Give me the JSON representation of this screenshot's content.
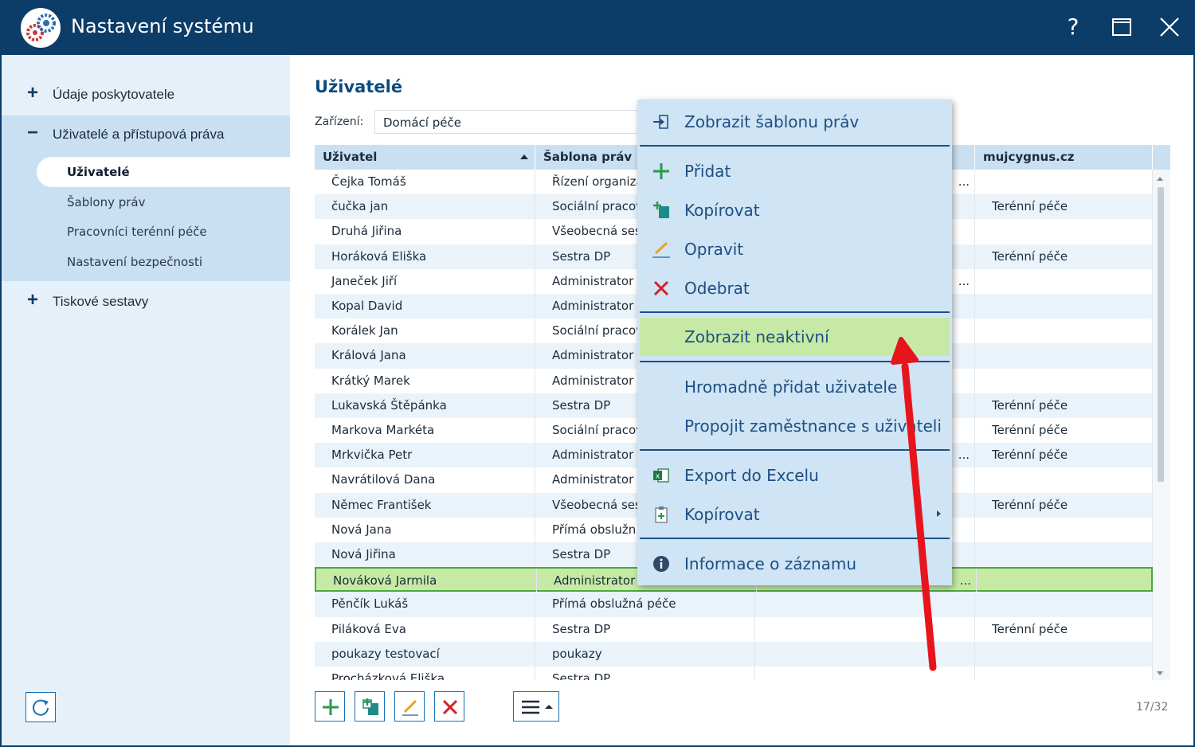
{
  "window": {
    "title": "Nastavení systému",
    "help": "?"
  },
  "sidebar": {
    "items": [
      {
        "sign": "+",
        "label": "Údaje poskytovatele"
      },
      {
        "sign": "−",
        "label": "Uživatelé a přístupová práva"
      },
      {
        "sign": "+",
        "label": "Tiskové sestavy"
      }
    ],
    "subitems": [
      {
        "label": "Uživatelé",
        "active": true
      },
      {
        "label": "Šablony práv"
      },
      {
        "label": "Pracovníci terénní péče"
      },
      {
        "label": "Nastavení bezpečnosti"
      }
    ]
  },
  "main": {
    "title": "Uživatelé",
    "facility_label": "Zařízení:",
    "facility_value": "Domácí péče"
  },
  "table": {
    "columns": [
      "Uživatel",
      "Šablona práv",
      "",
      "mujcygnus.cz"
    ],
    "rows": [
      [
        "Čejka Tomáš",
        "Řízení organiza",
        "...",
        ""
      ],
      [
        "čučka jan",
        "Sociální pracov",
        "",
        "Terénní péče"
      ],
      [
        "Druhá Jiřina",
        "Všeobecná ses",
        "",
        ""
      ],
      [
        "Horáková Eliška",
        "Sestra DP",
        "",
        "Terénní péče"
      ],
      [
        "Janeček Jiří",
        "Administrator",
        "...",
        ""
      ],
      [
        "Kopal David",
        "Administrator",
        "",
        ""
      ],
      [
        "Korálek Jan",
        "Sociální pracov",
        "",
        ""
      ],
      [
        "Králová Jana",
        "Administrator",
        "",
        ""
      ],
      [
        "Krátký Marek",
        "Administrator",
        "",
        ""
      ],
      [
        "Lukavská Štěpánka",
        "Sestra DP",
        "",
        "Terénní péče"
      ],
      [
        "Markova Markéta",
        "Sociální pracov",
        "",
        "Terénní péče"
      ],
      [
        "Mrkvička Petr",
        "Administrator",
        "...",
        "Terénní péče"
      ],
      [
        "Navrátilová Dana",
        "Administrator",
        "",
        ""
      ],
      [
        "Němec František",
        "Všeobecná ses",
        "",
        "Terénní péče"
      ],
      [
        "Nová Jana",
        "Přímá obslužn",
        "",
        ""
      ],
      [
        "Nová Jiřina",
        "Sestra DP",
        "",
        ""
      ],
      [
        "Nováková Jarmila",
        "Administrator",
        "...",
        ""
      ],
      [
        "Pěnčík Lukáš",
        "Přímá obslužná péče",
        "",
        ""
      ],
      [
        "Piláková Eva",
        "Sestra DP",
        "",
        "Terénní péče"
      ],
      [
        "poukazy testovací",
        "poukazy",
        "",
        ""
      ],
      [
        "Procházková Eliška",
        "Sestra DP",
        "",
        ""
      ]
    ],
    "selected_index": 16,
    "counter": "17/32"
  },
  "context_menu": {
    "items": [
      {
        "label": "Zobrazit šablonu práv",
        "icon": "template-icon"
      },
      {
        "label": "Přidat",
        "icon": "plus-icon"
      },
      {
        "label": "Kopírovat",
        "icon": "copy-icon"
      },
      {
        "label": "Opravit",
        "icon": "pencil-icon"
      },
      {
        "label": "Odebrat",
        "icon": "delete-x-icon"
      },
      {
        "label": "Zobrazit neaktivní",
        "highlighted": true
      },
      {
        "label": "Hromadně přidat uživatele"
      },
      {
        "label": "Propojit zaměstnance s uživateli"
      },
      {
        "label": "Export do Excelu",
        "icon": "excel-icon"
      },
      {
        "label": "Kopírovat",
        "icon": "clipboard-icon",
        "submenu": true
      },
      {
        "label": "Informace o záznamu",
        "icon": "info-icon"
      }
    ]
  },
  "colors": {
    "titlebar": "#0c3c68",
    "sidebar": "#e6f0f8",
    "sidebar_expanded": "#c9e0f2",
    "table_header": "#c9e0f2",
    "selected_row": "#c6eaa6",
    "menu_bg": "#cfe4f4",
    "menu_text": "#1d4f82",
    "annotation_arrow": "#e8141c"
  }
}
